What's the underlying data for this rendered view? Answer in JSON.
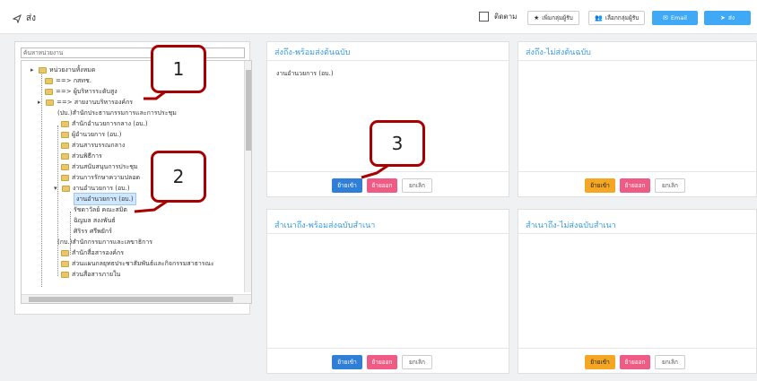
{
  "topbar": {
    "title": "ส่ง",
    "checkbox_label": "ติดตาม",
    "buttons": [
      {
        "label": "เพิ่มกลุ่มผู้รับ",
        "icon": "star-icon"
      },
      {
        "label": "เลือกกลุ่มผู้รับ",
        "icon": "users-icon"
      },
      {
        "label": "Email",
        "icon": "envelope-icon"
      },
      {
        "label": "ส่ง",
        "icon": "send-icon"
      }
    ]
  },
  "tree": {
    "search_placeholder": "ค้นหาหน่วยงาน",
    "nodes": [
      "หน่วยงานทั้งหมด",
      "==> กสทช.",
      "==> ผู้บริหารระดับสูง",
      "==> สายงานบริหารองค์กร",
      "(ปบ.)สำนักประธานกรรมการและการประชุม",
      "สำนักอำนวยการกลาง (อบ.)",
      "ผู้อำนวยการ (อบ.)",
      "ส่วนสารบรรณกลาง",
      "ส่วนพิธีการ",
      "ส่วนสนับสนุนการประชุม",
      "ส่วนการรักษาความปลอด",
      "งานอำนวยการ (อบ.)",
      "งานอำนวยการ (อบ.)",
      "รัชดาวัลย์ คณะสมิต",
      "ฉิญมล สงงพันธ์",
      "ศิริรร ศรีพยักร์",
      "(กบ.)สำนักกรรมการและเลขาธิการ",
      "สำนักสื่อสารองค์กร",
      "ส่วนแผนกลยุทธประชาสัมพันธ์และกิจกรรมสาธารณะ",
      "ส่วนสื่อสารภายใน"
    ]
  },
  "cards": [
    {
      "title": "ส่งถึง-พร้อมส่งต้นฉบับ",
      "items": [
        "งานอำนวยการ (อบ.)"
      ],
      "buttons": [
        "ย้ายเข้า",
        "ย้ายออก",
        "ยกเลิก"
      ]
    },
    {
      "title": "ส่งถึง-ไม่ส่งต้นฉบับ",
      "items": [],
      "buttons": [
        "ย้ายเข้า",
        "ย้ายออก",
        "ยกเลิก"
      ]
    },
    {
      "title": "สำเนาถึง-พร้อมส่งฉบับสำเนา",
      "items": [],
      "buttons": [
        "ย้ายเข้า",
        "ย้ายออก",
        "ยกเลิก"
      ]
    },
    {
      "title": "สำเนาถึง-ไม่ส่งฉบับสำเนา",
      "items": [],
      "buttons": [
        "ย้ายเข้า",
        "ย้ายออก",
        "ยกเลิก"
      ]
    }
  ],
  "callouts": [
    "1",
    "2",
    "3"
  ],
  "colors": {
    "accent": "#3a9be0",
    "callout_border": "#a80000",
    "pink": "#ef5b84",
    "orange": "#f5a623",
    "blue": "#2f7fd6"
  }
}
